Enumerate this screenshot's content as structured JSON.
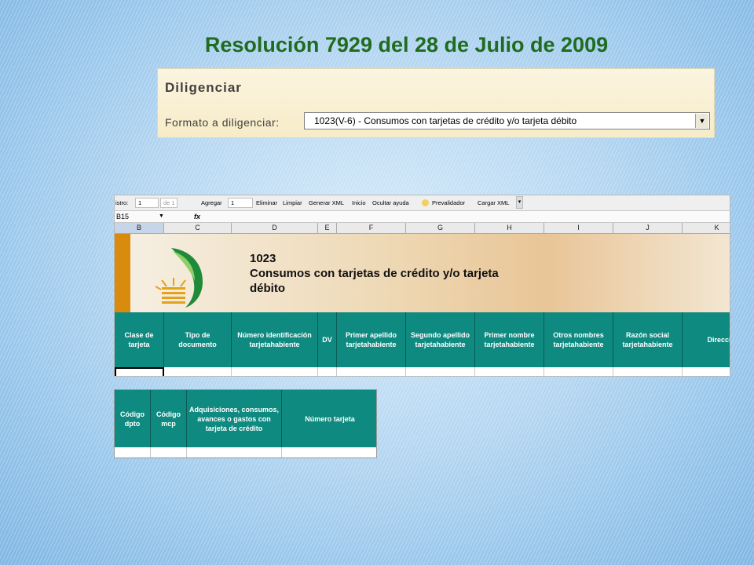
{
  "slide": {
    "title": "Resolución 7929 del 28 de Julio de 2009"
  },
  "diligenciar": {
    "title": "Diligenciar",
    "label": "Formato a diligenciar:",
    "selected_value": "1023(V-6) - Consumos con tarjetas de crédito y/o  tarjeta débito"
  },
  "excel": {
    "toolbar": {
      "registro_label": "istro:",
      "registro_value": "1",
      "de_label": "de 1",
      "agregar_label": "Agregar",
      "agregar_value": "1",
      "eliminar": "Eliminar",
      "limpiar": "Limpiar",
      "generar_xml": "Generar XML",
      "inicio": "Inicio",
      "ocultar_ayuda": "Ocultar ayuda",
      "prevalidador": "Prevalidador",
      "cargar_xml": "Cargar XML"
    },
    "name_box": "B15",
    "fx_symbol": "fx",
    "columns": [
      "B",
      "C",
      "D",
      "E",
      "F",
      "G",
      "H",
      "I",
      "J",
      "K"
    ],
    "banner": {
      "code": "1023",
      "title_line1": "Consumos con tarjetas de crédito y/o  tarjeta",
      "title_line2": "débito"
    },
    "headers": [
      "Clase de tarjeta",
      "Tipo de documento",
      "Número identificación tarjetahabiente",
      "DV",
      "Primer apellido tarjetahabiente",
      "Segundo apellido tarjetahabiente",
      "Primer nombre tarjetahabiente",
      "Otros nombres tarjetahabiente",
      "Razón social tarjetahabiente",
      "Direcció"
    ]
  },
  "table2": {
    "headers": [
      "Código dpto",
      "Código mcp",
      "Adquisiciones, consumos, avances o gastos con tarjeta de crédito",
      "Número tarjeta"
    ]
  },
  "colors": {
    "title_green": "#1f6b1f",
    "header_teal": "#0f8a80",
    "banner_orange": "#d98b0e"
  }
}
